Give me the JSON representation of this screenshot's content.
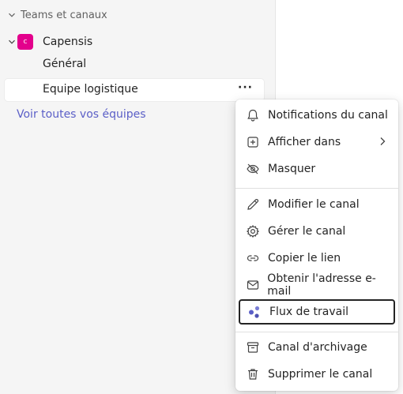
{
  "sidebar": {
    "section_title": "Teams et canaux",
    "team": {
      "avatar_letter": "c",
      "name": "Capensis"
    },
    "channels": [
      {
        "name": "Général"
      },
      {
        "name": "Equipe logistique",
        "more": "···"
      }
    ],
    "see_all": "Voir toutes vos équipes"
  },
  "context_menu": {
    "items": [
      {
        "label": "Notifications du canal",
        "icon": "bell-icon"
      },
      {
        "label": "Afficher dans",
        "icon": "add-square-icon",
        "has_submenu": true
      },
      {
        "label": "Masquer",
        "icon": "eye-off-icon"
      },
      {
        "label": "Modifier le canal",
        "icon": "pencil-icon"
      },
      {
        "label": "Gérer le canal",
        "icon": "gear-icon"
      },
      {
        "label": "Copier le lien",
        "icon": "link-icon"
      },
      {
        "label": "Obtenir l'adresse e-mail",
        "icon": "mail-icon"
      },
      {
        "label": "Flux de travail",
        "icon": "workflow-icon",
        "focused": true
      },
      {
        "label": "Canal d'archivage",
        "icon": "archive-icon"
      },
      {
        "label": "Supprimer le canal",
        "icon": "trash-icon"
      }
    ]
  },
  "colors": {
    "accent": "#5b5fc7",
    "team_avatar": "#e3008c",
    "workflow_icon": "#5b5fc7"
  }
}
